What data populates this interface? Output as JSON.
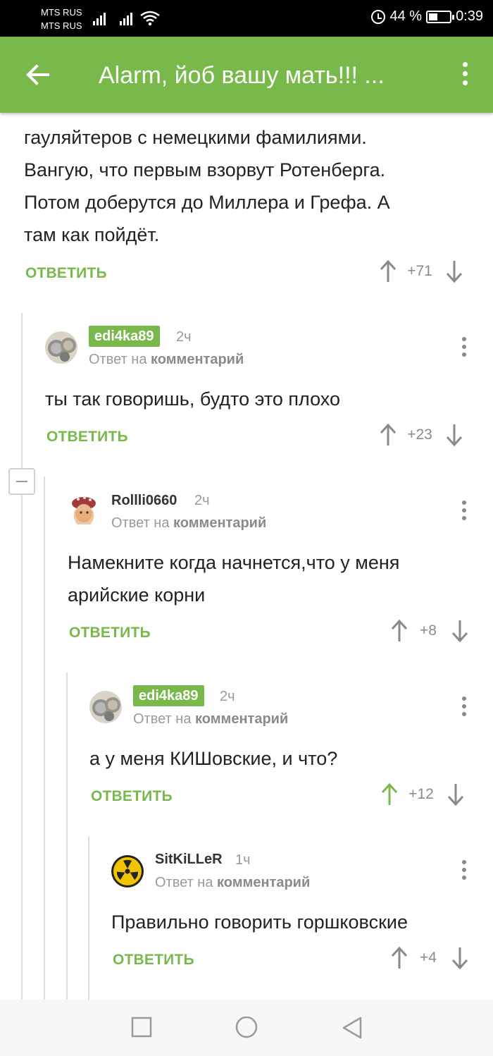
{
  "status_bar": {
    "carrier1": "MTS RUS",
    "carrier2": "MTS RUS",
    "battery_text": "44 %",
    "battery_level": 0.44,
    "time": "0:39"
  },
  "app_bar": {
    "title": "Alarm, йоб вашу мать!!! ...",
    "back_icon": "arrow-left",
    "menu_icon": "kebab-vertical"
  },
  "top_comment": {
    "lines": [
      "гауляйтеров с немецкими фамилиями.",
      "Вангую, что первым взорвут Ротенберга.",
      "Потом доберутся до Миллера и Грефа. А",
      "там как пойдёт."
    ],
    "reply_label": "ОТВЕТИТЬ",
    "score": "+71"
  },
  "comments": [
    {
      "user": "edi4ka89",
      "highlighted": true,
      "time": "2ч",
      "sub_prefix": "Ответ на",
      "sub_link": "комментарий",
      "text_lines": [
        "ты так говоришь, будто это плохо"
      ],
      "reply_label": "ОТВЕТИТЬ",
      "score": "+23",
      "upvoted": false
    },
    {
      "user": "Rollli0660",
      "highlighted": false,
      "time": "2ч",
      "sub_prefix": "Ответ на",
      "sub_link": "комментарий",
      "text_lines": [
        "Намекните когда начнется,что у меня",
        "арийские корни"
      ],
      "reply_label": "ОТВЕТИТЬ",
      "score": "+8",
      "upvoted": false
    },
    {
      "user": "edi4ka89",
      "highlighted": true,
      "time": "2ч",
      "sub_prefix": "Ответ на",
      "sub_link": "комментарий",
      "text_lines": [
        "а у меня КИШовские, и что?"
      ],
      "reply_label": "ОТВЕТИТЬ",
      "score": "+12",
      "upvoted": true
    },
    {
      "user": "SitKiLLeR",
      "highlighted": false,
      "time": "1ч",
      "sub_prefix": "Ответ на",
      "sub_link": "комментарий",
      "text_lines": [
        "Правильно говорить горшковские"
      ],
      "reply_label": "ОТВЕТИТЬ",
      "score": "+4",
      "upvoted": false
    }
  ],
  "colors": {
    "accent": "#79b84a",
    "text": "#222222",
    "muted": "#9a9a9a",
    "status_bar": "#000000",
    "nav_bar": "#f7f7f7"
  },
  "nav_bar": {
    "icons": [
      "recent-apps-square-icon",
      "home-circle-icon",
      "back-triangle-icon"
    ]
  }
}
